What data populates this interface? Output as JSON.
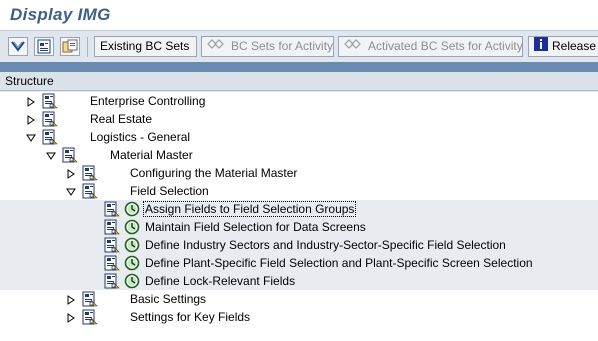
{
  "window": {
    "title": "Display IMG"
  },
  "toolbar": {
    "existing_bc_sets": "Existing BC Sets",
    "bc_sets_for_activity": "BC Sets for Activity",
    "activated_bc_sets_for_activity": "Activated BC Sets for Activity",
    "release_notes": "Release"
  },
  "tree": {
    "header": "Structure",
    "rows": [
      {
        "label": "Enterprise Controlling",
        "expanded": false,
        "clock": false
      },
      {
        "label": "Real Estate",
        "expanded": false,
        "clock": false
      },
      {
        "label": "Logistics - General",
        "expanded": true,
        "clock": false
      },
      {
        "label": "Material Master",
        "expanded": true,
        "clock": false
      },
      {
        "label": "Configuring the Material Master",
        "expanded": false,
        "clock": false
      },
      {
        "label": "Field Selection",
        "expanded": true,
        "clock": false
      },
      {
        "label": "Assign Fields to Field Selection Groups",
        "clock": true,
        "selected": true
      },
      {
        "label": "Maintain Field Selection for Data Screens",
        "clock": true
      },
      {
        "label": "Define Industry Sectors and Industry-Sector-Specific Field Selection",
        "clock": true
      },
      {
        "label": "Define Plant-Specific Field Selection and Plant-Specific Screen Selection",
        "clock": true
      },
      {
        "label": "Define Lock-Relevant Fields",
        "clock": true
      },
      {
        "label": "Basic Settings",
        "expanded": false,
        "clock": false
      },
      {
        "label": "Settings for Key Fields",
        "expanded": false,
        "clock": false
      }
    ]
  }
}
